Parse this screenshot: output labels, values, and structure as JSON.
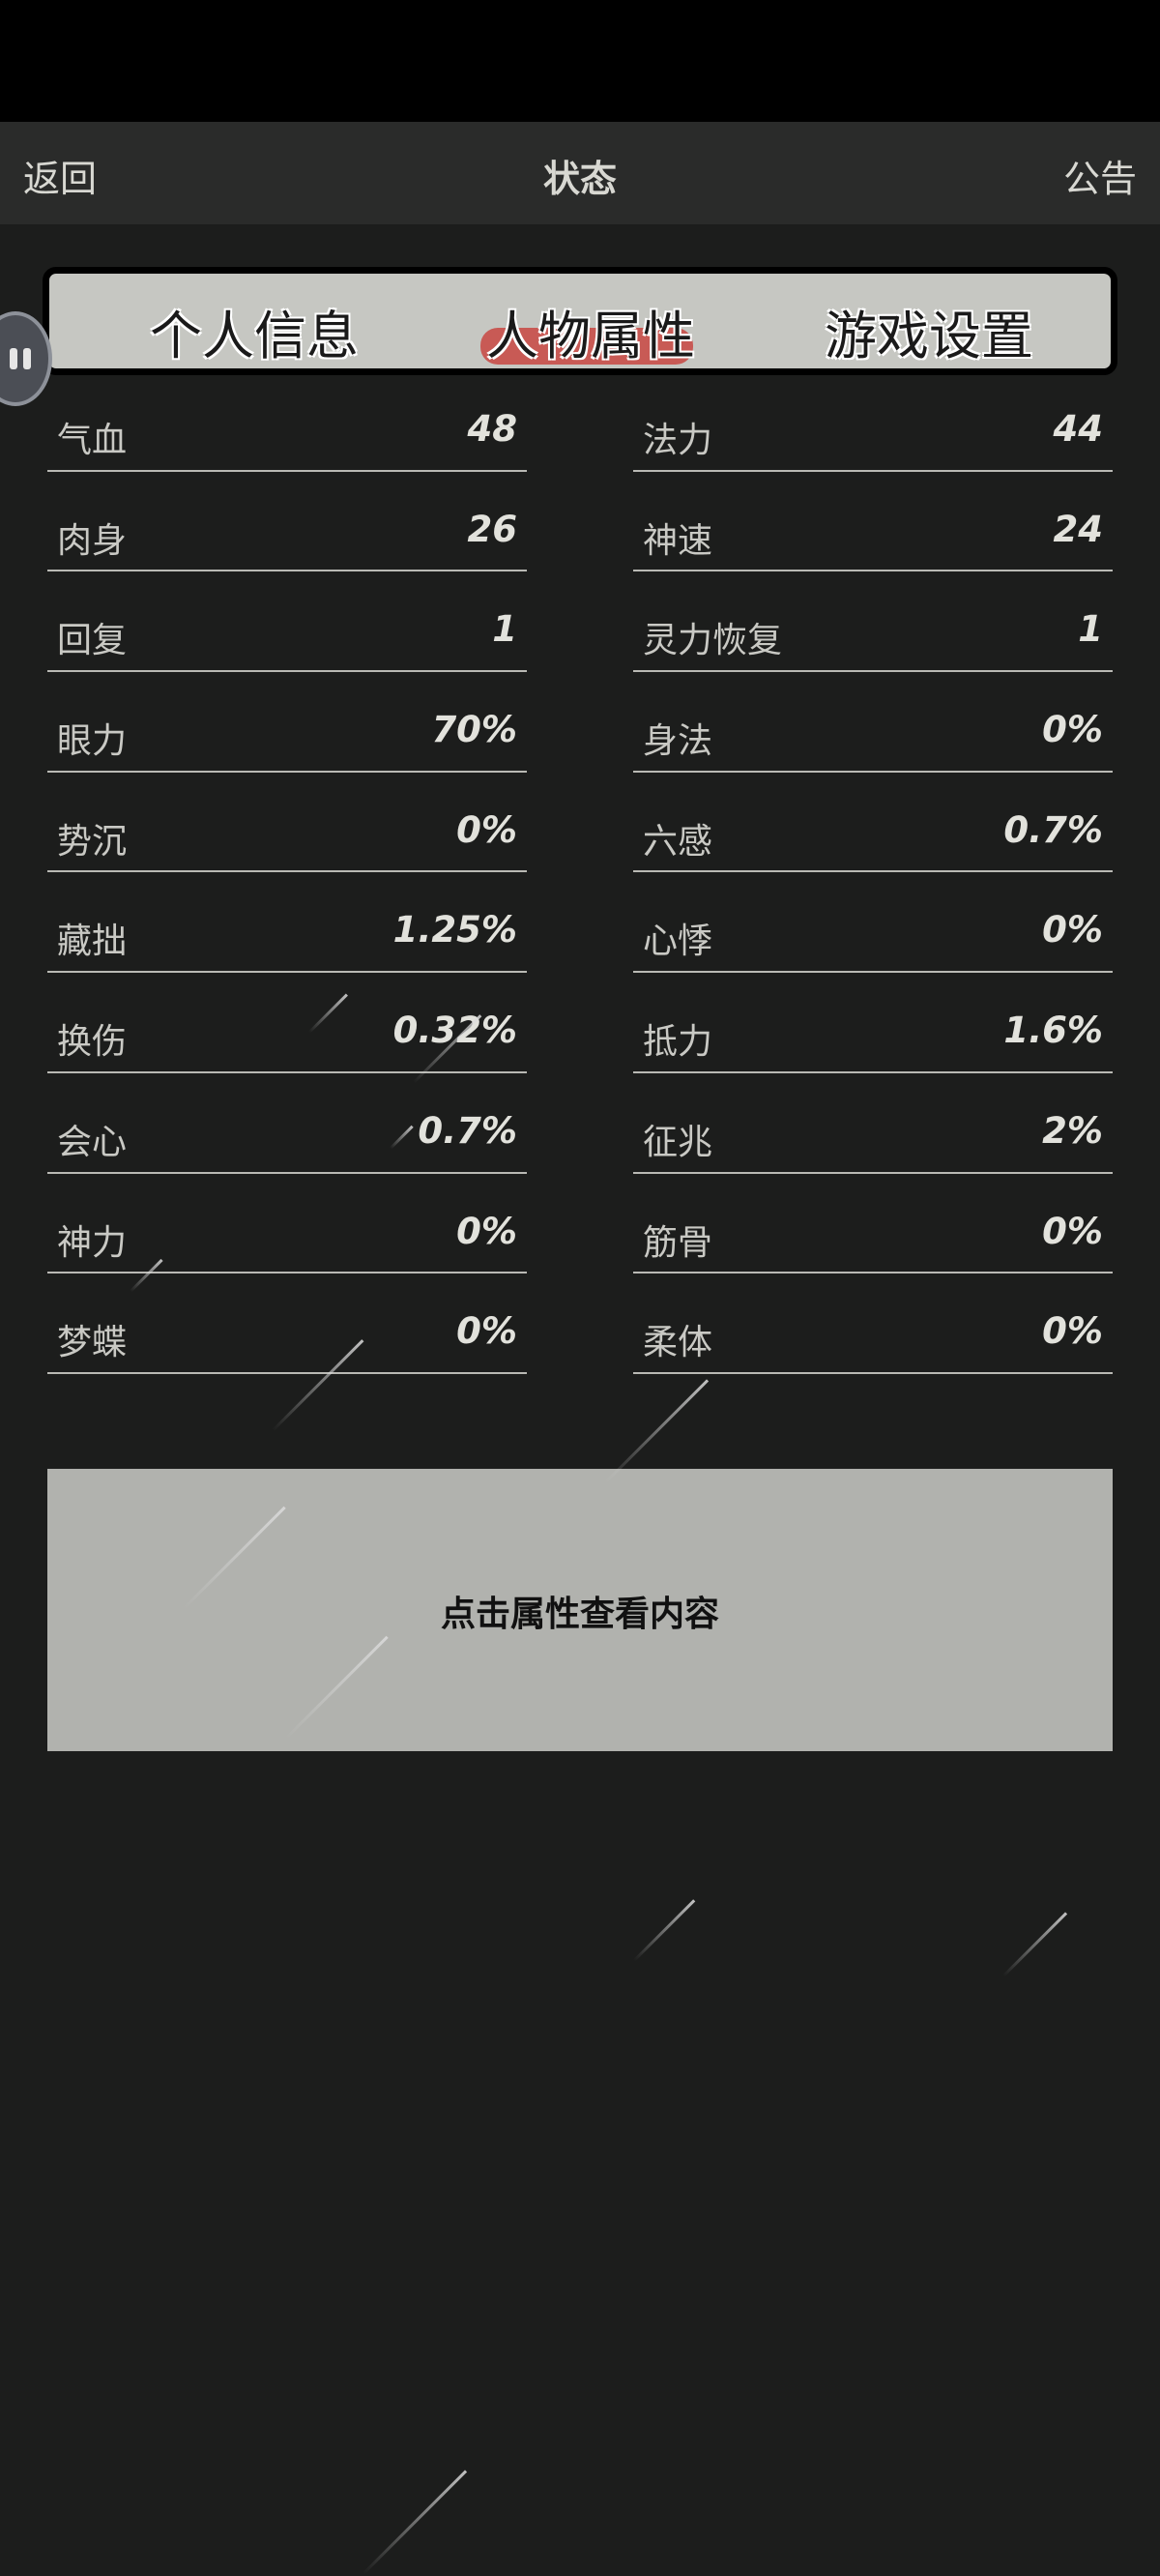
{
  "nav": {
    "back_label": "返回",
    "title": "状态",
    "notice_label": "公告"
  },
  "tabs": [
    {
      "label": "个人信息",
      "active": false
    },
    {
      "label": "人物属性",
      "active": true
    },
    {
      "label": "游戏设置",
      "active": false
    }
  ],
  "attributes_left": [
    {
      "name": "气血",
      "value": "48"
    },
    {
      "name": "肉身",
      "value": "26"
    },
    {
      "name": "回复",
      "value": "1"
    },
    {
      "name": "眼力",
      "value": "70%"
    },
    {
      "name": "势沉",
      "value": "0%"
    },
    {
      "name": "藏拙",
      "value": "1.25%"
    },
    {
      "name": "换伤",
      "value": "0.32%"
    },
    {
      "name": "会心",
      "value": "0.7%"
    },
    {
      "name": "神力",
      "value": "0%"
    },
    {
      "name": "梦蝶",
      "value": "0%"
    }
  ],
  "attributes_right": [
    {
      "name": "法力",
      "value": "44"
    },
    {
      "name": "神速",
      "value": "24"
    },
    {
      "name": "灵力恢复",
      "value": "1"
    },
    {
      "name": "身法",
      "value": "0%"
    },
    {
      "name": "六感",
      "value": "0.7%"
    },
    {
      "name": "心悸",
      "value": "0%"
    },
    {
      "name": "抵力",
      "value": "1.6%"
    },
    {
      "name": "征兆",
      "value": "2%"
    },
    {
      "name": "筋骨",
      "value": "0%"
    },
    {
      "name": "柔体",
      "value": "0%"
    }
  ],
  "info_box": {
    "hint": "点击属性查看内容"
  },
  "colors": {
    "background": "#1c1d1c",
    "active_tab_highlight": "#c85a55",
    "tabbar_bg": "#c6c7c2",
    "info_box_bg": "#b1b2ae"
  },
  "icons": {
    "floating_button": "pause-icon"
  }
}
